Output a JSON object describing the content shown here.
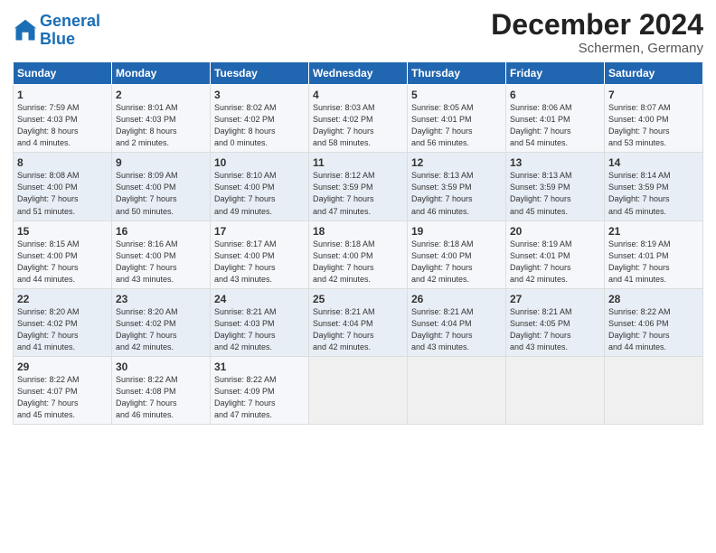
{
  "header": {
    "logo_line1": "General",
    "logo_line2": "Blue",
    "month": "December 2024",
    "location": "Schermen, Germany"
  },
  "days_of_week": [
    "Sunday",
    "Monday",
    "Tuesday",
    "Wednesday",
    "Thursday",
    "Friday",
    "Saturday"
  ],
  "weeks": [
    [
      {
        "day": "1",
        "text": "Sunrise: 7:59 AM\nSunset: 4:03 PM\nDaylight: 8 hours\nand 4 minutes."
      },
      {
        "day": "2",
        "text": "Sunrise: 8:01 AM\nSunset: 4:03 PM\nDaylight: 8 hours\nand 2 minutes."
      },
      {
        "day": "3",
        "text": "Sunrise: 8:02 AM\nSunset: 4:02 PM\nDaylight: 8 hours\nand 0 minutes."
      },
      {
        "day": "4",
        "text": "Sunrise: 8:03 AM\nSunset: 4:02 PM\nDaylight: 7 hours\nand 58 minutes."
      },
      {
        "day": "5",
        "text": "Sunrise: 8:05 AM\nSunset: 4:01 PM\nDaylight: 7 hours\nand 56 minutes."
      },
      {
        "day": "6",
        "text": "Sunrise: 8:06 AM\nSunset: 4:01 PM\nDaylight: 7 hours\nand 54 minutes."
      },
      {
        "day": "7",
        "text": "Sunrise: 8:07 AM\nSunset: 4:00 PM\nDaylight: 7 hours\nand 53 minutes."
      }
    ],
    [
      {
        "day": "8",
        "text": "Sunrise: 8:08 AM\nSunset: 4:00 PM\nDaylight: 7 hours\nand 51 minutes."
      },
      {
        "day": "9",
        "text": "Sunrise: 8:09 AM\nSunset: 4:00 PM\nDaylight: 7 hours\nand 50 minutes."
      },
      {
        "day": "10",
        "text": "Sunrise: 8:10 AM\nSunset: 4:00 PM\nDaylight: 7 hours\nand 49 minutes."
      },
      {
        "day": "11",
        "text": "Sunrise: 8:12 AM\nSunset: 3:59 PM\nDaylight: 7 hours\nand 47 minutes."
      },
      {
        "day": "12",
        "text": "Sunrise: 8:13 AM\nSunset: 3:59 PM\nDaylight: 7 hours\nand 46 minutes."
      },
      {
        "day": "13",
        "text": "Sunrise: 8:13 AM\nSunset: 3:59 PM\nDaylight: 7 hours\nand 45 minutes."
      },
      {
        "day": "14",
        "text": "Sunrise: 8:14 AM\nSunset: 3:59 PM\nDaylight: 7 hours\nand 45 minutes."
      }
    ],
    [
      {
        "day": "15",
        "text": "Sunrise: 8:15 AM\nSunset: 4:00 PM\nDaylight: 7 hours\nand 44 minutes."
      },
      {
        "day": "16",
        "text": "Sunrise: 8:16 AM\nSunset: 4:00 PM\nDaylight: 7 hours\nand 43 minutes."
      },
      {
        "day": "17",
        "text": "Sunrise: 8:17 AM\nSunset: 4:00 PM\nDaylight: 7 hours\nand 43 minutes."
      },
      {
        "day": "18",
        "text": "Sunrise: 8:18 AM\nSunset: 4:00 PM\nDaylight: 7 hours\nand 42 minutes."
      },
      {
        "day": "19",
        "text": "Sunrise: 8:18 AM\nSunset: 4:00 PM\nDaylight: 7 hours\nand 42 minutes."
      },
      {
        "day": "20",
        "text": "Sunrise: 8:19 AM\nSunset: 4:01 PM\nDaylight: 7 hours\nand 42 minutes."
      },
      {
        "day": "21",
        "text": "Sunrise: 8:19 AM\nSunset: 4:01 PM\nDaylight: 7 hours\nand 41 minutes."
      }
    ],
    [
      {
        "day": "22",
        "text": "Sunrise: 8:20 AM\nSunset: 4:02 PM\nDaylight: 7 hours\nand 41 minutes."
      },
      {
        "day": "23",
        "text": "Sunrise: 8:20 AM\nSunset: 4:02 PM\nDaylight: 7 hours\nand 42 minutes."
      },
      {
        "day": "24",
        "text": "Sunrise: 8:21 AM\nSunset: 4:03 PM\nDaylight: 7 hours\nand 42 minutes."
      },
      {
        "day": "25",
        "text": "Sunrise: 8:21 AM\nSunset: 4:04 PM\nDaylight: 7 hours\nand 42 minutes."
      },
      {
        "day": "26",
        "text": "Sunrise: 8:21 AM\nSunset: 4:04 PM\nDaylight: 7 hours\nand 43 minutes."
      },
      {
        "day": "27",
        "text": "Sunrise: 8:21 AM\nSunset: 4:05 PM\nDaylight: 7 hours\nand 43 minutes."
      },
      {
        "day": "28",
        "text": "Sunrise: 8:22 AM\nSunset: 4:06 PM\nDaylight: 7 hours\nand 44 minutes."
      }
    ],
    [
      {
        "day": "29",
        "text": "Sunrise: 8:22 AM\nSunset: 4:07 PM\nDaylight: 7 hours\nand 45 minutes."
      },
      {
        "day": "30",
        "text": "Sunrise: 8:22 AM\nSunset: 4:08 PM\nDaylight: 7 hours\nand 46 minutes."
      },
      {
        "day": "31",
        "text": "Sunrise: 8:22 AM\nSunset: 4:09 PM\nDaylight: 7 hours\nand 47 minutes."
      },
      null,
      null,
      null,
      null
    ]
  ]
}
